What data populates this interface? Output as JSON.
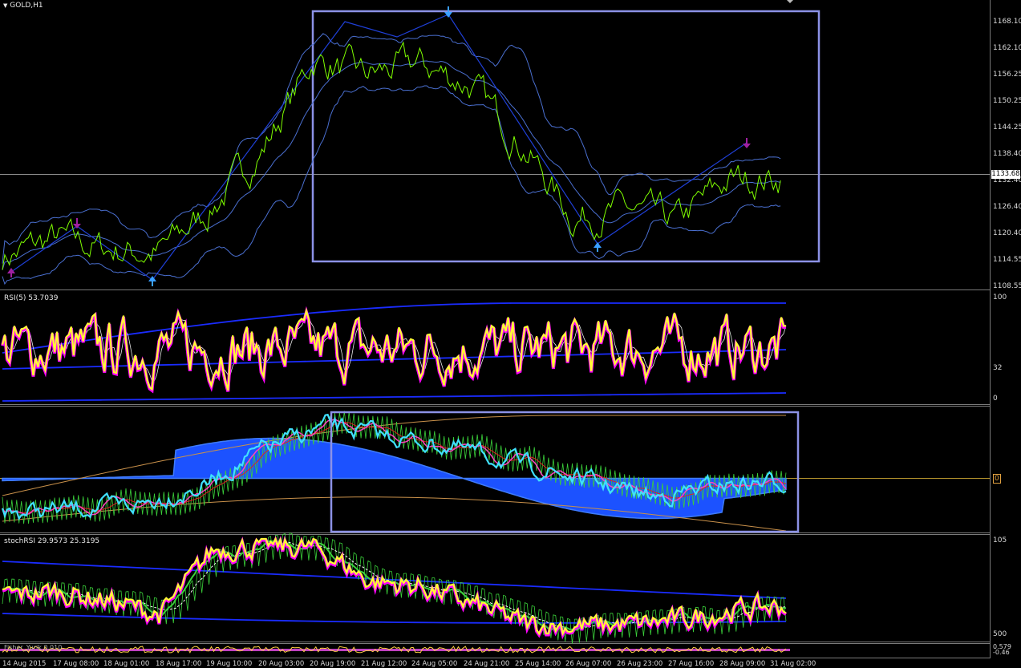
{
  "window": {
    "symbol_title": "GOLD,H1"
  },
  "colors": {
    "background": "#000000",
    "grid": "#5a5a5a",
    "price_line": "#7fff00",
    "bands": "#4a6fd0",
    "zigzag": "#1f3fd6",
    "box": "#8c92e6",
    "rsi_main": "#ffff33",
    "rsi_edge": "#ff00ff",
    "hist": "#1c52ff",
    "cyan": "#40e0ff"
  },
  "main_panel": {
    "price_axis": [
      "1168.10",
      "1162.10",
      "1156.25",
      "1150.25",
      "1144.25",
      "1138.40",
      "1132.40",
      "1126.40",
      "1120.40",
      "1114.55",
      "1108.55"
    ],
    "current_price": "1133.68",
    "y_range": [
      1106.5,
      1171.0
    ]
  },
  "rsi_panel": {
    "label": "RSI(5) 53.7039",
    "levels": [
      "100",
      "32",
      "0"
    ]
  },
  "macd_panel": {
    "label": "",
    "level_marker": "0"
  },
  "stochrsi_panel": {
    "label": "stochRSI 29.9573 25.3195",
    "levels": [
      "105",
      "500"
    ]
  },
  "bottom_panel": {
    "label": "Fisher_Yurik 0.010",
    "levels": [
      "0.579",
      "-0.46"
    ]
  },
  "time_axis": [
    "14 Aug 2015",
    "17 Aug 08:00",
    "18 Aug 01:00",
    "18 Aug 17:00",
    "19 Aug 10:00",
    "20 Aug 03:00",
    "20 Aug 19:00",
    "21 Aug 12:00",
    "24 Aug 05:00",
    "24 Aug 21:00",
    "25 Aug 14:00",
    "26 Aug 07:00",
    "26 Aug 23:00",
    "27 Aug 16:00",
    "28 Aug 09:00",
    "31 Aug 02:00"
  ],
  "chart_data": {
    "type": "line",
    "title": "GOLD,H1",
    "x": [
      "14 Aug 2015",
      "17 Aug 08:00",
      "18 Aug 01:00",
      "18 Aug 17:00",
      "19 Aug 10:00",
      "20 Aug 03:00",
      "20 Aug 19:00",
      "21 Aug 12:00",
      "24 Aug 05:00",
      "24 Aug 21:00",
      "25 Aug 14:00",
      "26 Aug 07:00",
      "26 Aug 23:00",
      "27 Aug 16:00",
      "28 Aug 09:00",
      "31 Aug 02:00"
    ],
    "series": [
      {
        "values": [
          1114.5,
          1119.0,
          1116.5,
          1115.5,
          1126.0,
          1140.0,
          1162.0,
          1158.0,
          1161.0,
          1156.0,
          1142.0,
          1124.0,
          1126.0,
          1123.0,
          1133.0,
          1133.7
        ]
      }
    ],
    "ylim": [
      1106.5,
      1171.0
    ],
    "yticks": [
      1168.1,
      1162.1,
      1156.25,
      1150.25,
      1144.25,
      1138.4,
      1132.4,
      1126.4,
      1120.4,
      1114.55,
      1108.55
    ],
    "grid": false
  }
}
